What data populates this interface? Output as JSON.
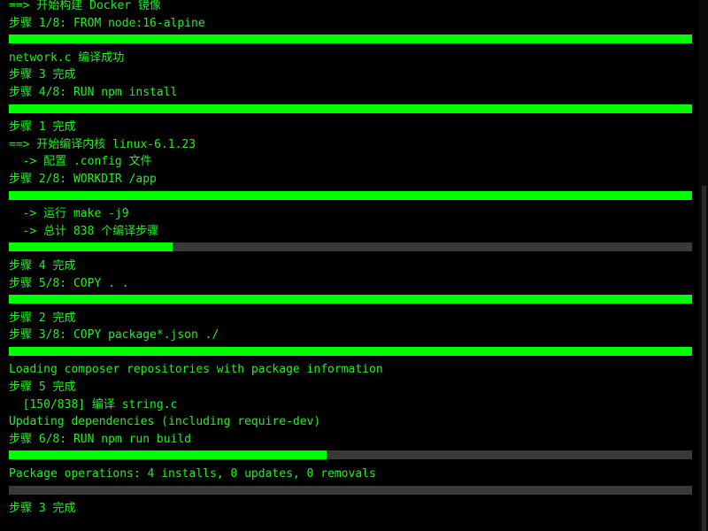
{
  "terminal": {
    "line_01": "==> 开始构建 Docker 镜像",
    "line_02": "步骤 1/8: FROM node:16-alpine",
    "bar_03": {
      "progress": 1.0
    },
    "line_04": "network.c 编译成功",
    "line_05": "步骤 3 完成",
    "line_06": "步骤 4/8: RUN npm install",
    "bar_07": {
      "progress": 1.0
    },
    "line_08": "步骤 1 完成",
    "line_09": "==> 开始编译内核 linux-6.1.23",
    "line_10": "  -> 配置 .config 文件",
    "line_11": "步骤 2/8: WORKDIR /app",
    "bar_12": {
      "progress": 1.0
    },
    "line_13": "  -> 运行 make -j9",
    "line_14": "  -> 总计 838 个编译步骤",
    "bar_15": {
      "progress": 0.24
    },
    "line_16": "步骤 4 完成",
    "line_17": "步骤 5/8: COPY . .",
    "bar_18": {
      "progress": 1.0
    },
    "line_19": "步骤 2 完成",
    "line_20": "步骤 3/8: COPY package*.json ./",
    "bar_21": {
      "progress": 1.0
    },
    "line_22": "Loading composer repositories with package information",
    "line_23": "步骤 5 完成",
    "line_24": "  [150/838] 编译 string.c",
    "line_25": "Updating dependencies (including require-dev)",
    "line_26": "步骤 6/8: RUN npm run build",
    "bar_27": {
      "progress": 0.465
    },
    "line_28": "Package operations: 4 installs, 0 updates, 0 removals",
    "bar_29": {
      "progress": 0.0
    },
    "line_30": "步骤 3 完成"
  },
  "colors": {
    "text": "#22ee22",
    "bar_fill": "#00ff00",
    "bar_track": "#3a3a3a",
    "background": "#000000"
  }
}
